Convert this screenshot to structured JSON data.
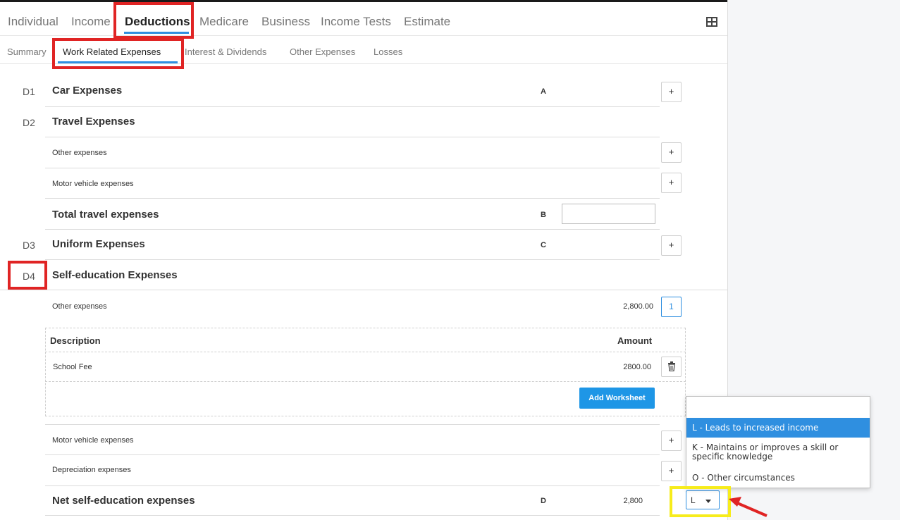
{
  "main_tabs": [
    "Individual",
    "Income",
    "Deductions",
    "Medicare",
    "Business",
    "Income Tests",
    "Estimate"
  ],
  "active_main_tab": "Deductions",
  "sub_tabs": [
    "Summary",
    "Work Related Expenses",
    "Interest & Dividends",
    "Other Expenses",
    "Losses"
  ],
  "active_sub_tab": "Work Related Expenses",
  "sections": {
    "d1": {
      "code": "D1",
      "title": "Car Expenses",
      "letter": "A"
    },
    "d2": {
      "code": "D2",
      "title": "Travel Expenses",
      "other": "Other expenses",
      "motor": "Motor vehicle expenses",
      "total": "Total travel expenses",
      "total_letter": "B",
      "total_value": ""
    },
    "d3": {
      "code": "D3",
      "title": "Uniform Expenses",
      "letter": "C"
    },
    "d4": {
      "code": "D4",
      "title": "Self-education Expenses",
      "other": "Other expenses",
      "other_amount": "2,800.00",
      "other_count": "1",
      "worksheet": {
        "col_description": "Description",
        "col_amount": "Amount",
        "row_description": "School Fee",
        "row_amount": "2800.00",
        "add_button": "Add Worksheet"
      },
      "motor": "Motor vehicle expenses",
      "depreciation": "Depreciation expenses",
      "net": "Net self-education expenses",
      "net_letter": "D",
      "net_amount": "2,800",
      "reason_value": "L"
    }
  },
  "plus_label": "+",
  "dropdown_options": [
    "",
    "L - Leads to increased income",
    "K - Maintains or improves a skill or specific knowledge",
    "O - Other circumstances"
  ],
  "dropdown_selected": "L - Leads to increased income",
  "icons": {
    "grid": "grid-icon",
    "trash": "trash-icon",
    "caret": "caret-down-icon"
  },
  "colors": {
    "accent": "#2f8fe0",
    "annotation_red": "#e02424",
    "annotation_yellow": "#f7ec1b"
  }
}
